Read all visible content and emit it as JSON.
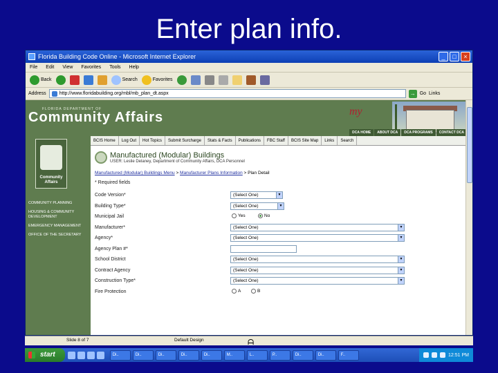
{
  "slide": {
    "title": "Enter plan info."
  },
  "window": {
    "title": "Florida Building Code Online - Microsoft Internet Explorer",
    "menu": [
      "File",
      "Edit",
      "View",
      "Favorites",
      "Tools",
      "Help"
    ],
    "toolbar": {
      "back": "Back",
      "search": "Search",
      "favorites": "Favorites"
    },
    "address_label": "Address",
    "address_value": "http://www.floridabuilding.org/mbl/mb_plan_dt.aspx",
    "go_label": "Go",
    "links_label": "Links"
  },
  "banner": {
    "dept_small": "FLORIDA DEPARTMENT OF",
    "dept_big": "Community Affairs",
    "logo_script": "my",
    "nav": [
      "DCA HOME",
      "ABOUT DCA",
      "DCA PROGRAMS",
      "CONTACT DCA"
    ]
  },
  "sidebar": {
    "logo_text": "Community Affairs",
    "links": [
      "COMMUNITY PLANNING",
      "HOUSING & COMMUNITY DEVELOPMENT",
      "EMERGENCY MANAGEMENT",
      "OFFICE OF THE SECRETARY"
    ]
  },
  "tabs": [
    "BCIS Home",
    "Log Out",
    "Hot Topics",
    "Submit Surcharge",
    "Stats & Facts",
    "Publications",
    "FBC Staff",
    "BCIS Site Map",
    "Links",
    "Search"
  ],
  "page": {
    "heading": "Manufactured (Modular) Buildings",
    "subheading": "USER: Leslie Delaney, Department of Community Affairs, DCA Personnel",
    "crumb_1": "Manufactured (Modular) Buildings Menu",
    "crumb_sep": ">",
    "crumb_2": "Manufacturer Plans Information",
    "crumb_3": "> Plan Detail",
    "required_note": "* Required fields"
  },
  "form": {
    "code_version": {
      "label": "Code Version*",
      "value": "(Select One)"
    },
    "building_type": {
      "label": "Building Type*",
      "value": "(Select One)"
    },
    "municipal_jail": {
      "label": "Municipal Jail",
      "yes": "Yes",
      "no": "No",
      "selected": "No"
    },
    "manufacturer": {
      "label": "Manufacturer*",
      "value": "(Select One)"
    },
    "agency": {
      "label": "Agency*",
      "value": "(Select One)"
    },
    "agency_plan": {
      "label": "Agency Plan #*",
      "value": ""
    },
    "school_district": {
      "label": "School District",
      "value": "(Select One)"
    },
    "contract_agency": {
      "label": "Contract Agency",
      "value": "(Select One)"
    },
    "construction_type": {
      "label": "Construction Type*",
      "value": "(Select One)"
    },
    "fire_protection": {
      "label": "Fire Protection",
      "a": "A",
      "b": "B"
    }
  },
  "status": {
    "left": "Slide 8 of 7",
    "middle": "Default Design"
  },
  "taskbar": {
    "start": "start",
    "tasks": [
      "Di..",
      "Di..",
      "Di..",
      "Di..",
      "Di..",
      "M..",
      "L..",
      "P..",
      "Di..",
      "Di..",
      "F.."
    ],
    "clock": "12:51 PM"
  }
}
